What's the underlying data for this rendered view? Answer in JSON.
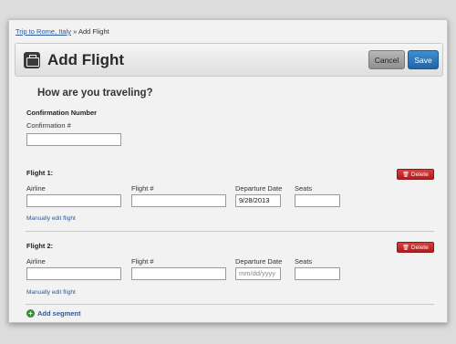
{
  "breadcrumb": {
    "trip": "Trip to Rome, Italy",
    "separator": " » ",
    "current": "Add Flight"
  },
  "header": {
    "title": "Add Flight",
    "icon": "suitcase-icon",
    "cancel_label": "Cancel",
    "save_label": "Save"
  },
  "question": "How are you traveling?",
  "confirmation": {
    "section_label": "Confirmation Number",
    "field_label": "Confirmation #",
    "value": ""
  },
  "flights": [
    {
      "title": "Flight 1:",
      "delete_label": "Delete",
      "airline_label": "Airline",
      "airline_value": "",
      "flightnum_label": "Flight #",
      "flightnum_value": "",
      "date_label": "Departure Date",
      "date_value": "9/28/2013",
      "seats_label": "Seats",
      "seats_value": "",
      "manual_link": "Manually edit flight"
    },
    {
      "title": "Flight 2:",
      "delete_label": "Delete",
      "airline_label": "Airline",
      "airline_value": "",
      "flightnum_label": "Flight #",
      "flightnum_value": "",
      "date_label": "Departure Date",
      "date_placeholder": "mm/dd/yyyy",
      "seats_label": "Seats",
      "seats_value": "",
      "manual_link": "Manually edit flight"
    }
  ],
  "add_segment_label": "Add segment",
  "colors": {
    "save": "#2a78bd",
    "delete": "#c02626",
    "link": "#2b5a9b",
    "add": "#3c8a3c"
  }
}
